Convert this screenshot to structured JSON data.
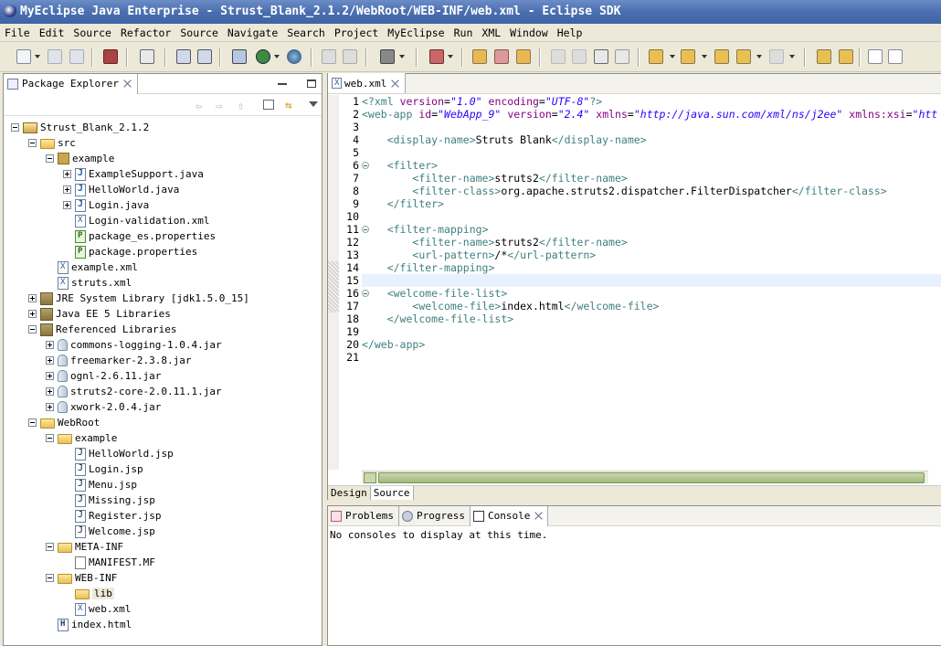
{
  "window": {
    "title": "MyEclipse Java Enterprise - Strust_Blank_2.1.2/WebRoot/WEB-INF/web.xml - Eclipse SDK"
  },
  "menu": [
    "File",
    "Edit",
    "Source",
    "Refactor",
    "Source",
    "Navigate",
    "Search",
    "Project",
    "MyEclipse",
    "Run",
    "XML",
    "Window",
    "Help"
  ],
  "package_explorer": {
    "title": "Package Explorer",
    "tree": [
      {
        "label": "Strust_Blank_2.1.2",
        "icon": "project-icon",
        "expander": "minus"
      },
      {
        "label": "src",
        "icon": "source-folder-icon",
        "expander": "minus"
      },
      {
        "label": "example",
        "icon": "package-icon",
        "expander": "minus"
      },
      {
        "label": "ExampleSupport.java",
        "icon": "java-file-icon",
        "expander": "plus"
      },
      {
        "label": "HelloWorld.java",
        "icon": "java-file-icon",
        "expander": "plus"
      },
      {
        "label": "Login.java",
        "icon": "java-file-icon",
        "expander": "plus"
      },
      {
        "label": "Login-validation.xml",
        "icon": "xml-file-icon",
        "expander": ""
      },
      {
        "label": "package_es.properties",
        "icon": "properties-file-icon",
        "expander": ""
      },
      {
        "label": "package.properties",
        "icon": "properties-file-icon",
        "expander": ""
      },
      {
        "label": "example.xml",
        "icon": "xml-file-icon",
        "expander": ""
      },
      {
        "label": "struts.xml",
        "icon": "xml-file-icon",
        "expander": ""
      },
      {
        "label": "JRE System Library [jdk1.5.0_15]",
        "icon": "library-icon",
        "expander": "plus"
      },
      {
        "label": "Java EE 5 Libraries",
        "icon": "library-icon",
        "expander": "plus"
      },
      {
        "label": "Referenced Libraries",
        "icon": "library-icon",
        "expander": "minus"
      },
      {
        "label": "commons-logging-1.0.4.jar",
        "icon": "jar-icon",
        "expander": "plus"
      },
      {
        "label": "freemarker-2.3.8.jar",
        "icon": "jar-icon",
        "expander": "plus"
      },
      {
        "label": "ognl-2.6.11.jar",
        "icon": "jar-icon",
        "expander": "plus"
      },
      {
        "label": "struts2-core-2.0.11.1.jar",
        "icon": "jar-icon",
        "expander": "plus"
      },
      {
        "label": "xwork-2.0.4.jar",
        "icon": "jar-icon",
        "expander": "plus"
      },
      {
        "label": "WebRoot",
        "icon": "folder-icon",
        "expander": "minus"
      },
      {
        "label": "example",
        "icon": "folder-icon",
        "expander": "minus"
      },
      {
        "label": "HelloWorld.jsp",
        "icon": "jsp-file-icon",
        "expander": ""
      },
      {
        "label": "Login.jsp",
        "icon": "jsp-file-icon",
        "expander": ""
      },
      {
        "label": "Menu.jsp",
        "icon": "jsp-file-icon",
        "expander": ""
      },
      {
        "label": "Missing.jsp",
        "icon": "jsp-file-icon",
        "expander": ""
      },
      {
        "label": "Register.jsp",
        "icon": "jsp-file-icon",
        "expander": ""
      },
      {
        "label": "Welcome.jsp",
        "icon": "jsp-file-icon",
        "expander": ""
      },
      {
        "label": "META-INF",
        "icon": "folder-icon",
        "expander": "minus"
      },
      {
        "label": "MANIFEST.MF",
        "icon": "manifest-file-icon",
        "expander": ""
      },
      {
        "label": "WEB-INF",
        "icon": "folder-icon",
        "expander": "minus"
      },
      {
        "label": "lib",
        "icon": "folder-icon",
        "expander": ""
      },
      {
        "label": "web.xml",
        "icon": "xml-file-icon",
        "expander": ""
      },
      {
        "label": "index.html",
        "icon": "html-file-icon",
        "expander": ""
      }
    ]
  },
  "editor": {
    "tab": "web.xml",
    "line_numbers": [
      "1",
      "2",
      "3",
      "4",
      "5",
      "6",
      "7",
      "8",
      "9",
      "10",
      "11",
      "12",
      "13",
      "14",
      "15",
      "16",
      "17",
      "18",
      "19",
      "20",
      "21"
    ],
    "lines": [
      "<?xml version=\"1.0\" encoding=\"UTF-8\"?>",
      "<web-app id=\"WebApp_9\" version=\"2.4\" xmlns=\"http://java.sun.com/xml/ns/j2ee\" xmlns:xsi=\"htt",
      "",
      "    <display-name>Struts Blank</display-name>",
      "",
      "    <filter>",
      "        <filter-name>struts2</filter-name>",
      "        <filter-class>org.apache.struts2.dispatcher.FilterDispatcher</filter-class>",
      "    </filter>",
      "",
      "    <filter-mapping>",
      "        <filter-name>struts2</filter-name>",
      "        <url-pattern>/*</url-pattern>",
      "    </filter-mapping>",
      "",
      "    <welcome-file-list>",
      "        <welcome-file>index.html</welcome-file>",
      "    </welcome-file-list>",
      "",
      "</web-app>",
      ""
    ],
    "bottom_tabs": [
      "Design",
      "Source"
    ],
    "active_bottom_tab": "Source"
  },
  "console": {
    "tabs": [
      "Problems",
      "Progress",
      "Console"
    ],
    "active_tab": "Console",
    "message": "No consoles to display at this time."
  }
}
